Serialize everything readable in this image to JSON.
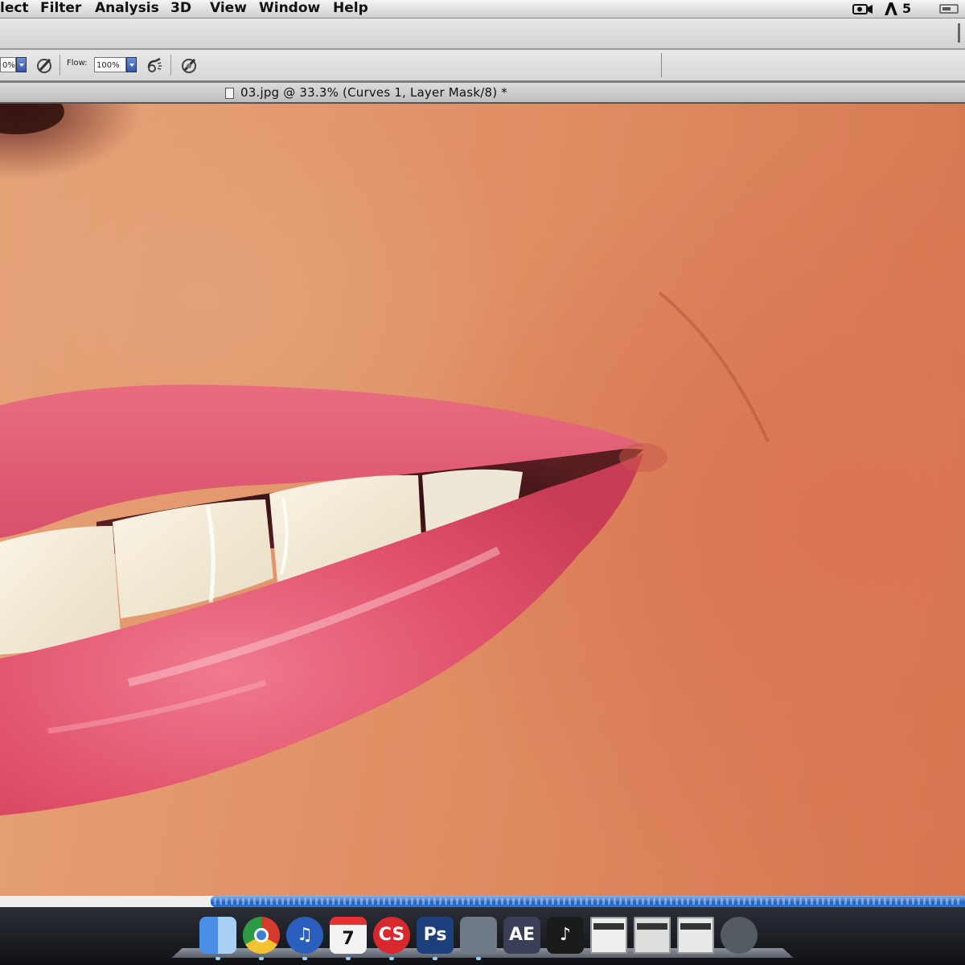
{
  "menubar": {
    "items": [
      {
        "label": "lect",
        "name": "menu-select"
      },
      {
        "label": "Filter",
        "name": "menu-filter"
      },
      {
        "label": "Analysis",
        "name": "menu-analysis"
      },
      {
        "label": "3D",
        "name": "menu-3d"
      },
      {
        "label": "View",
        "name": "menu-view"
      },
      {
        "label": "Window",
        "name": "menu-window"
      },
      {
        "label": "Help",
        "name": "menu-help"
      }
    ],
    "right_badge": "5",
    "right_icons": [
      "camera-icon",
      "adobe-updater-icon",
      "menu-extra-icon"
    ]
  },
  "options_bar": {
    "opacity_value": "0%",
    "flow_label": "Flow:",
    "flow_value": "100%",
    "icons": [
      "pressure-opacity-icon",
      "airbrush-icon",
      "pressure-size-icon"
    ]
  },
  "document": {
    "title": "03.jpg @ 33.3% (Curves 1, Layer Mask/8) *"
  },
  "progress": {
    "fraction": 0.78
  },
  "dock": {
    "apps": [
      {
        "name": "finder-icon",
        "glyph": "",
        "color": "#3b7fd6"
      },
      {
        "name": "chrome-icon",
        "glyph": "",
        "color": "#d33c2c"
      },
      {
        "name": "itunes-icon",
        "glyph": "♫",
        "color": "#2b5fbf"
      },
      {
        "name": "calendar-icon",
        "glyph": "7",
        "color": "#f2f2f2"
      },
      {
        "name": "creative-suite-icon",
        "glyph": "CS",
        "color": "#d8282e"
      },
      {
        "name": "photoshop-icon",
        "glyph": "Ps",
        "color": "#1d3f7a"
      },
      {
        "name": "clapper-icon",
        "glyph": "",
        "color": "#6f7a86"
      },
      {
        "name": "after-effects-icon",
        "glyph": "AE",
        "color": "#3a3f57"
      },
      {
        "name": "music-note-icon",
        "glyph": "♪",
        "color": "#1b1b1b"
      },
      {
        "name": "browser-window-icon",
        "glyph": "",
        "color": "#eeeeee"
      },
      {
        "name": "monitor-icon",
        "glyph": "",
        "color": "#dddddd"
      },
      {
        "name": "spreadsheet-window-icon",
        "glyph": "",
        "color": "#e8e8e8"
      },
      {
        "name": "trash-icon",
        "glyph": "",
        "color": "#555b63"
      }
    ]
  }
}
